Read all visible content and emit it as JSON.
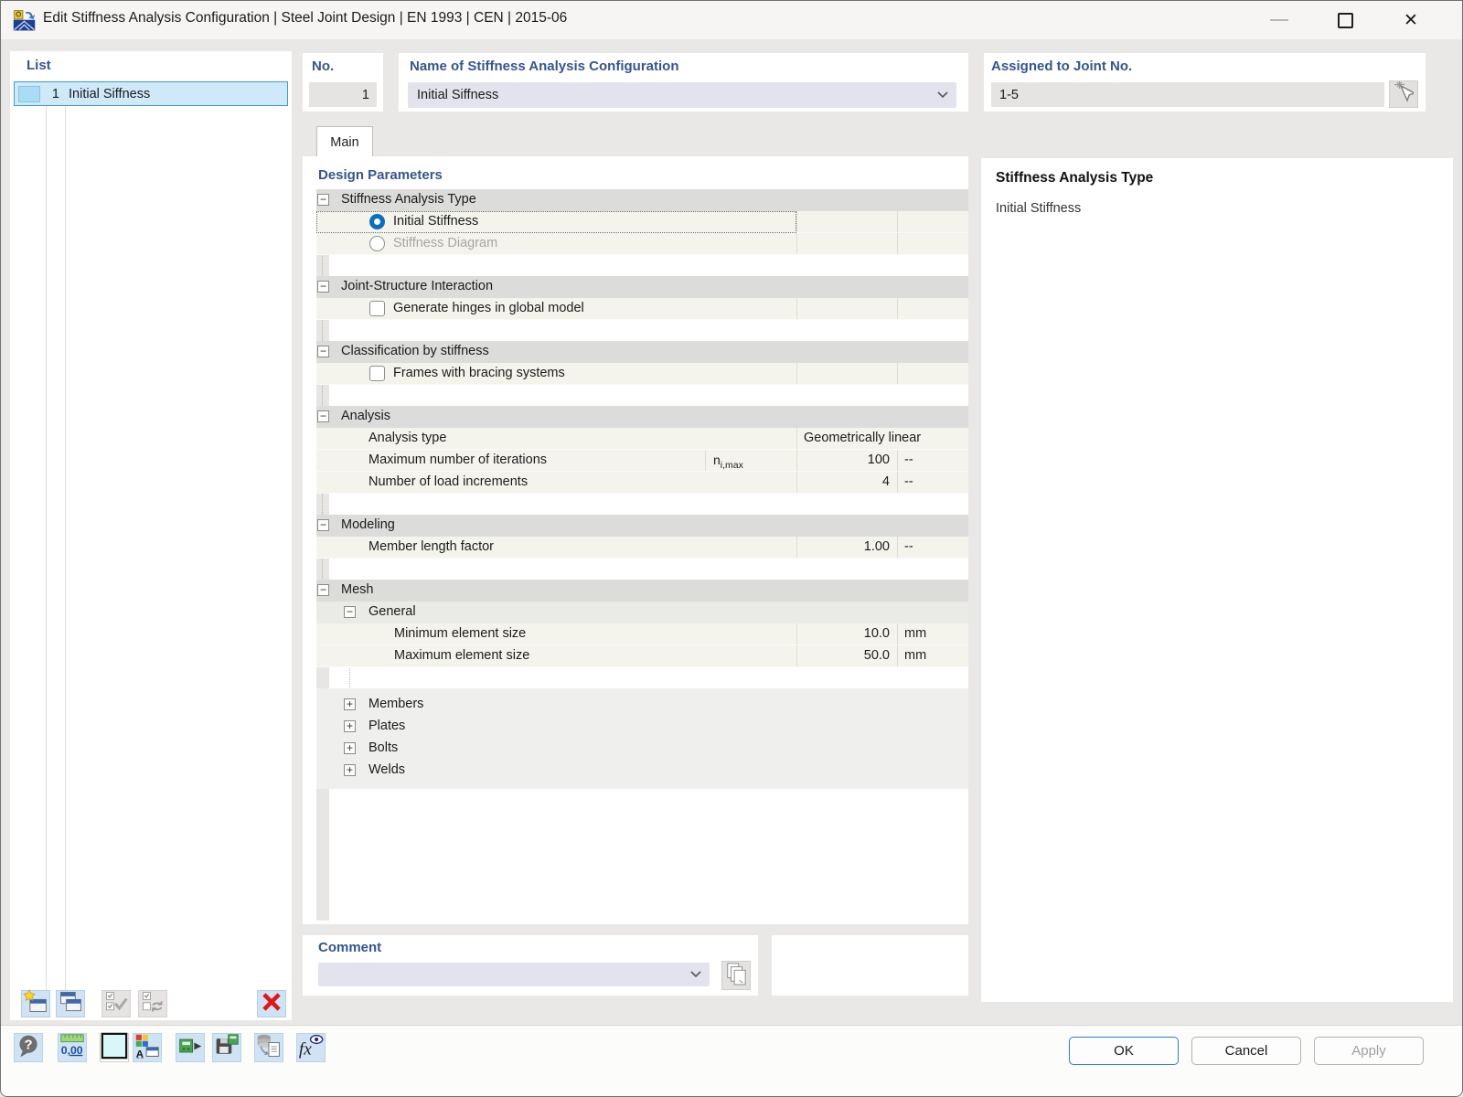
{
  "window": {
    "title": "Edit Stiffness Analysis Configuration | Steel Joint Design | EN 1993 | CEN | 2015-06",
    "controls": {
      "minimize": "minimize",
      "maximize": "maximize",
      "close": "✕"
    }
  },
  "list_panel": {
    "header": "List",
    "items": [
      {
        "no": "1",
        "name": "Initial Siffness",
        "swatch_color": "#a9dcf5",
        "selected": true
      }
    ],
    "toolbar": [
      {
        "name": "new-item-button",
        "icon": "new-window-icon",
        "disabled": false
      },
      {
        "name": "copy-item-button",
        "icon": "copy-window-icon",
        "disabled": false
      },
      {
        "name": "check-all-button",
        "icon": "check-all-icon",
        "disabled": true
      },
      {
        "name": "check-sync-button",
        "icon": "check-sync-icon",
        "disabled": true
      },
      {
        "name": "delete-item-button",
        "icon": "delete-x-icon",
        "disabled": false
      }
    ]
  },
  "header_fields": {
    "no": {
      "label": "No.",
      "value": "1"
    },
    "name": {
      "label": "Name of Stiffness Analysis Configuration",
      "value": "Initial Siffness"
    },
    "assigned": {
      "label": "Assigned to Joint No.",
      "value": "1-5"
    }
  },
  "tabs": [
    {
      "label": "Main",
      "active": true
    }
  ],
  "design_parameters": {
    "header": "Design Parameters",
    "rows": [
      {
        "type": "section",
        "label": "Stiffness Analysis Type"
      },
      {
        "type": "radio",
        "label": "Initial Stiffness",
        "checked": true,
        "focused": true
      },
      {
        "type": "radio",
        "label": "Stiffness Diagram",
        "checked": false,
        "disabled": true
      },
      {
        "type": "spacer"
      },
      {
        "type": "section",
        "label": "Joint-Structure Interaction"
      },
      {
        "type": "checkbox",
        "label": "Generate hinges in global model",
        "checked": false
      },
      {
        "type": "spacer"
      },
      {
        "type": "section",
        "label": "Classification by stiffness"
      },
      {
        "type": "checkbox",
        "label": "Frames with bracing systems",
        "checked": false
      },
      {
        "type": "spacer"
      },
      {
        "type": "section",
        "label": "Analysis"
      },
      {
        "type": "param",
        "label": "Analysis type",
        "value": "Geometrically linear",
        "wide": true
      },
      {
        "type": "param",
        "label": "Maximum number of iterations",
        "symbol": "n",
        "symbol_sub": "i,max",
        "value": "100",
        "unit": "--"
      },
      {
        "type": "param",
        "label": "Number of load increments",
        "value": "4",
        "unit": "--"
      },
      {
        "type": "spacer"
      },
      {
        "type": "section",
        "label": "Modeling"
      },
      {
        "type": "param",
        "label": "Member length factor",
        "value": "1.00",
        "unit": "--"
      },
      {
        "type": "spacer"
      },
      {
        "type": "section",
        "label": "Mesh"
      },
      {
        "type": "subsection",
        "label": "General"
      },
      {
        "type": "param",
        "label": "Minimum element size",
        "value": "10.0",
        "unit": "mm",
        "level": 3
      },
      {
        "type": "param",
        "label": "Maximum element size",
        "value": "50.0",
        "unit": "mm",
        "level": 3
      },
      {
        "type": "spacer"
      },
      {
        "type": "group",
        "items": [
          "Members",
          "Plates",
          "Bolts",
          "Welds"
        ]
      }
    ]
  },
  "info_panel": {
    "title": "Stiffness Analysis Type",
    "value": "Initial Stiffness"
  },
  "comment": {
    "label": "Comment",
    "value": ""
  },
  "bottom_toolbar": [
    {
      "name": "help-button",
      "icon": "help-icon"
    },
    {
      "name": "units-settings-button",
      "icon": "units-icon"
    },
    {
      "name": "color-swatch-button",
      "icon": "color-swatch-icon"
    },
    {
      "name": "display-options-button",
      "icon": "display-options-icon"
    },
    {
      "name": "import-config-button",
      "icon": "import-block-icon"
    },
    {
      "name": "save-config-button",
      "icon": "save-block-icon"
    },
    {
      "name": "database-button",
      "icon": "database-doc-icon"
    },
    {
      "name": "formula-visibility-button",
      "icon": "formula-eye-icon"
    }
  ],
  "dialog_buttons": [
    {
      "label": "OK",
      "primary": true,
      "disabled": false
    },
    {
      "label": "Cancel",
      "primary": false,
      "disabled": false
    },
    {
      "label": "Apply",
      "primary": false,
      "disabled": true
    }
  ],
  "colors": {
    "accent_label_blue": "#35568c",
    "radio_selected_blue": "#0a6fc2",
    "list_selection_fill": "#cfe9f9",
    "list_selection_border": "#3a9bd5",
    "section_row_grey": "#dcdcda",
    "item_row_cream": "#f4f4ed",
    "toolbar_tile_blue": "#cfe3f4",
    "delete_red": "#e01616"
  }
}
